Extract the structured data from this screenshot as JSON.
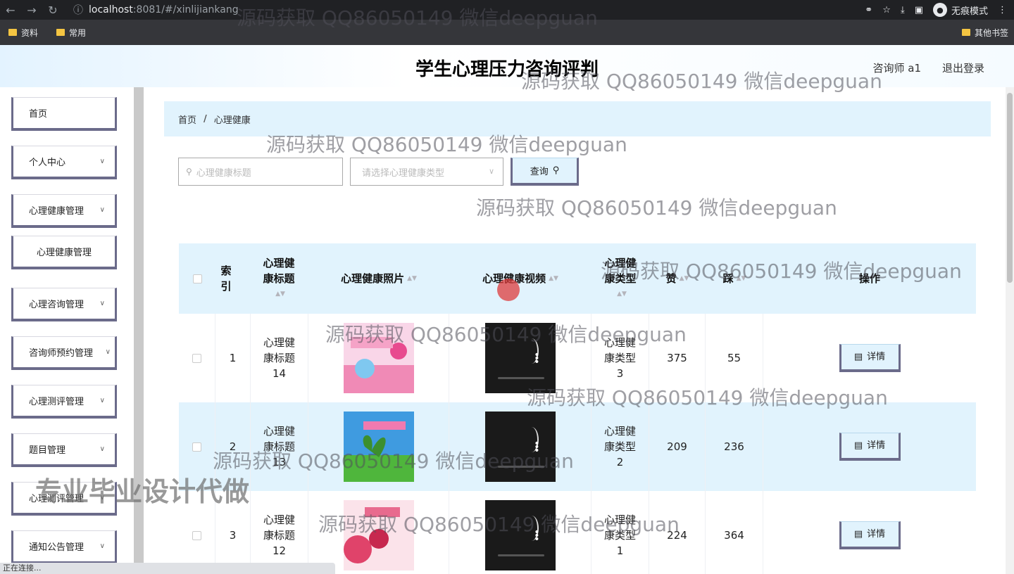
{
  "browser": {
    "url_host": "localhost",
    "url_rest": ":8081/#/xinlijiankang",
    "incognito_label": "无痕模式",
    "bookmarks": [
      "资料",
      "常用"
    ],
    "bookmarks_right": "其他书签",
    "status": "正在连接..."
  },
  "header": {
    "title": "学生心理压力咨询评判",
    "user": "咨询师 a1",
    "logout": "退出登录"
  },
  "sidebar": {
    "items": [
      {
        "label": "首页"
      },
      {
        "label": "个人中心"
      },
      {
        "label": "心理健康管理"
      },
      {
        "label": "心理健康管理"
      },
      {
        "label": "心理咨询管理"
      },
      {
        "label": "咨询师预约管理"
      },
      {
        "label": "心理测评管理"
      },
      {
        "label": "题目管理"
      },
      {
        "label": "心理测评管理"
      },
      {
        "label": "通知公告管理"
      }
    ]
  },
  "breadcrumb": {
    "home": "首页",
    "separator": "/",
    "current": "心理健康"
  },
  "search": {
    "title_placeholder": "心理健康标题",
    "type_placeholder": "请选择心理健康类型",
    "query_button": "查询"
  },
  "table": {
    "headers": {
      "index": "索引",
      "title": "心理健康标题",
      "photo": "心理健康照片",
      "video": "心理健康视频",
      "type": "心理健康类型",
      "likes": "赞",
      "dislikes": "踩",
      "actions": "操作"
    },
    "rows": [
      {
        "index": "1",
        "title": "心理健康标题14",
        "type": "心理健康类型3",
        "likes": "375",
        "dislikes": "55",
        "action": "详情"
      },
      {
        "index": "2",
        "title": "心理健康标题13",
        "type": "心理健康类型2",
        "likes": "209",
        "dislikes": "236",
        "action": "详情"
      },
      {
        "index": "3",
        "title": "心理健康标题12",
        "type": "心理健康类型1",
        "likes": "224",
        "dislikes": "364",
        "action": "详情"
      }
    ]
  },
  "overlay": {
    "watermark": "源码获取 QQ86050149 微信deepguan",
    "promo": "专业毕业设计代做"
  },
  "colors": {
    "accent_bg": "#e1f3fd",
    "button_border": "#6b6b8a"
  }
}
